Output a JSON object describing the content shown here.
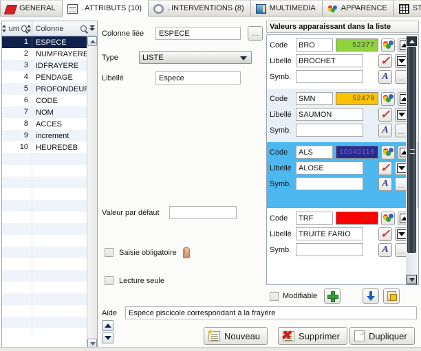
{
  "tabs": [
    {
      "label": "GENERAL",
      "icon": "red-parallelogram-icon",
      "active": false
    },
    {
      "label": ". ATTRIBUTS (10)",
      "icon": "table-icon",
      "active": true
    },
    {
      "label": ". INTERVENTIONS (8)",
      "icon": "gear-icon",
      "active": false
    },
    {
      "label": "MULTIMEDIA",
      "icon": "image-icon",
      "active": false
    },
    {
      "label": "APPARENCE",
      "icon": "color-palette-icon",
      "active": false
    },
    {
      "label": "STRUCTURE",
      "icon": "grid-icon",
      "active": false
    }
  ],
  "column_list": {
    "headers": {
      "num": "um",
      "name": "Colonne"
    },
    "rows": [
      {
        "num": "1",
        "name": "ESPECE",
        "selected": true
      },
      {
        "num": "2",
        "name": "NUMFRAYERE",
        "selected": false
      },
      {
        "num": "3",
        "name": "IDFRAYERE",
        "selected": false
      },
      {
        "num": "4",
        "name": "PENDAGE",
        "selected": false
      },
      {
        "num": "5",
        "name": "PROFONDEUR",
        "selected": false
      },
      {
        "num": "6",
        "name": "CODE",
        "selected": false
      },
      {
        "num": "7",
        "name": "NOM",
        "selected": false
      },
      {
        "num": "8",
        "name": "ACCES",
        "selected": false
      },
      {
        "num": "9",
        "name": "increment",
        "selected": false
      },
      {
        "num": "10",
        "name": "HEUREDEB",
        "selected": false
      }
    ]
  },
  "form": {
    "colonne_liee_label": "Colonne liée",
    "colonne_liee_value": "ESPECE",
    "browse_label": "...",
    "type_label": "Type",
    "type_value": "LISTE",
    "libelle_label": "Libellé",
    "libelle_value": "Espece",
    "valeur_defaut_label": "Valeur par défaut",
    "valeur_defaut_value": "",
    "saisie_obligatoire_label": "Saisie obligatoire",
    "lecture_seule_label": "Lecture seule"
  },
  "values_panel": {
    "title": "Valeurs apparaissant dans la liste",
    "labels": {
      "code": "Code",
      "libelle": "Libellé",
      "symb": "Symb."
    },
    "items": [
      {
        "code": "BRO",
        "color_value": "52377",
        "color_hex": "#8fd43c",
        "libelle": "BROCHET",
        "symb": "",
        "selected": false
      },
      {
        "code": "SMN",
        "color_value": "52479",
        "color_hex": "#fcc300",
        "libelle": "SAUMON",
        "symb": "",
        "selected": false
      },
      {
        "code": "ALS",
        "color_value": "10040116",
        "color_hex": "#2b2b8f",
        "libelle": "ALOSE",
        "symb": "",
        "selected": true
      },
      {
        "code": "TRF",
        "color_value": "255",
        "color_hex": "#fb0000",
        "libelle": "TRUITE FARIO",
        "symb": "",
        "selected": false
      }
    ],
    "modifiable_label": "Modifiable",
    "add_label": "+",
    "import_label": "",
    "paste_label": ""
  },
  "footer": {
    "aide_label": "Aide",
    "aide_value": "Espéce piscicole correspondant à la frayére",
    "nouveau_label": "Nouveau",
    "supprimer_label": "Supprimer",
    "dupliquer_label": "Dupliquer"
  }
}
